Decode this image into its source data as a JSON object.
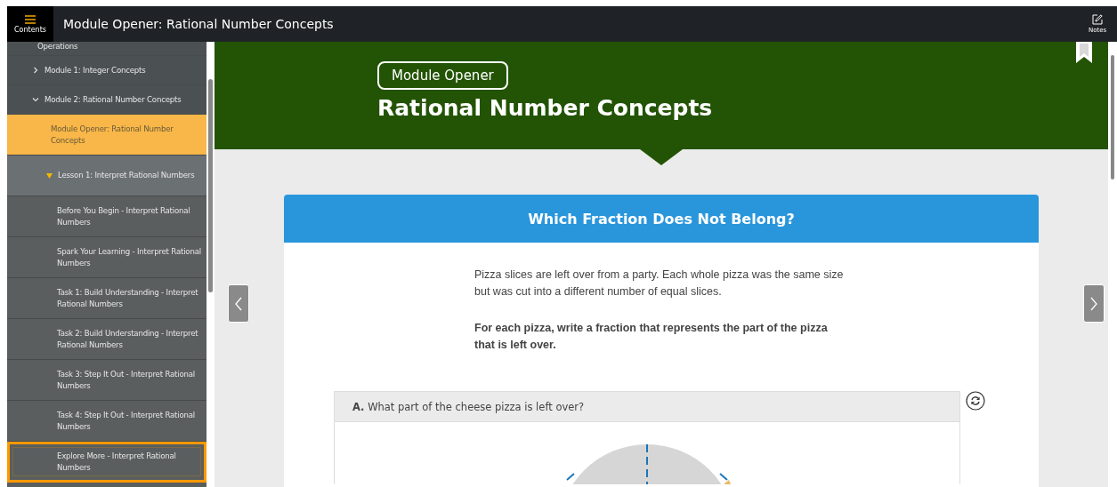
{
  "top_bar": {
    "menu_label": "Contents",
    "title": "Module Opener: Rational Number Concepts",
    "notes_label": "Notes"
  },
  "sidebar": {
    "items": [
      {
        "kind": "partial",
        "label": "Operations",
        "selected": false,
        "focused": false
      },
      {
        "kind": "module",
        "label": "Module 1: Integer Concepts",
        "expanded": false,
        "selected": false,
        "focused": false
      },
      {
        "kind": "module",
        "label": "Module 2: Rational Number Concepts",
        "expanded": true,
        "selected": false,
        "focused": false
      },
      {
        "kind": "page",
        "label": "Module Opener: Rational Number Concepts",
        "selected": true,
        "focused": false
      },
      {
        "kind": "lesson",
        "label": "Lesson 1: Interpret Rational Numbers",
        "expanded": true,
        "selected": false,
        "focused": false
      },
      {
        "kind": "task",
        "label": "Before You Begin - Interpret Rational Numbers",
        "selected": false,
        "focused": false
      },
      {
        "kind": "task",
        "label": "Spark Your Learning - Interpret Rational Numbers",
        "selected": false,
        "focused": false
      },
      {
        "kind": "task",
        "label": "Task 1: Build Understanding - Interpret Rational Numbers",
        "selected": false,
        "focused": false
      },
      {
        "kind": "task",
        "label": "Task 2: Build Understanding - Interpret Rational Numbers",
        "selected": false,
        "focused": false
      },
      {
        "kind": "task",
        "label": "Task 3: Step It Out - Interpret Rational Numbers",
        "selected": false,
        "focused": false
      },
      {
        "kind": "task",
        "label": "Task 4: Step It Out - Interpret Rational Numbers",
        "selected": false,
        "focused": false
      },
      {
        "kind": "task",
        "label": "Explore More - Interpret Rational Numbers",
        "selected": false,
        "focused": true
      }
    ]
  },
  "banner": {
    "badge": "Module Opener",
    "title": "Rational Number Concepts"
  },
  "card": {
    "title": "Which Fraction Does Not Belong?",
    "paragraphs": [
      {
        "text": "Pizza slices are left over from a party. Each whole pizza was the same size but was cut into a different number of equal slices.",
        "bold": false
      },
      {
        "text": "For each pizza, write a fraction that represents the part of the pizza that is left over.",
        "bold": true
      }
    ],
    "question": {
      "text": "**A.** What part of the cheese pizza is left over?"
    }
  }
}
